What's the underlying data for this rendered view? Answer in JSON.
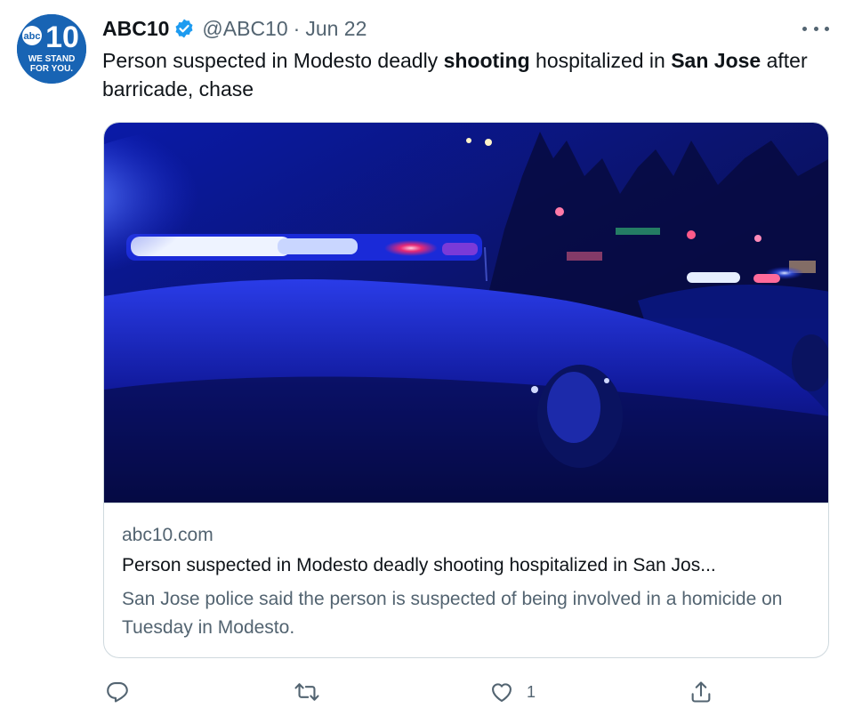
{
  "author": {
    "display_name": "ABC10",
    "handle": "@ABC10",
    "separator": "·",
    "date": "Jun 22",
    "avatar": {
      "logo_text": "abc10",
      "tagline_line1": "WE STAND",
      "tagline_line2": "FOR YOU."
    }
  },
  "tweet": {
    "text_parts": [
      {
        "text": "Person suspected in Modesto deadly ",
        "bold": false
      },
      {
        "text": "shooting",
        "bold": true
      },
      {
        "text": " hospitalized in ",
        "bold": false
      },
      {
        "text": "San Jose",
        "bold": true
      },
      {
        "text": " after barricade, chase",
        "bold": false
      }
    ]
  },
  "card": {
    "domain": "abc10.com",
    "title": "Person suspected in Modesto deadly shooting hospitalized in San Jos...",
    "description": "San Jose police said the person is suspected of being involved in a homicide on Tuesday in Modesto.",
    "image_subject": "police-car-lights-at-night"
  },
  "actions": {
    "reply": {
      "icon": "reply-icon",
      "count": ""
    },
    "retweet": {
      "icon": "retweet-icon",
      "count": ""
    },
    "like": {
      "icon": "heart-icon",
      "count": "1"
    },
    "share": {
      "icon": "share-icon",
      "count": ""
    }
  },
  "colors": {
    "text_primary": "#0f1419",
    "text_secondary": "#536471",
    "border": "#cfd9de",
    "verified_blue": "#1d9bf0",
    "avatar_blue": "#1864b4"
  }
}
